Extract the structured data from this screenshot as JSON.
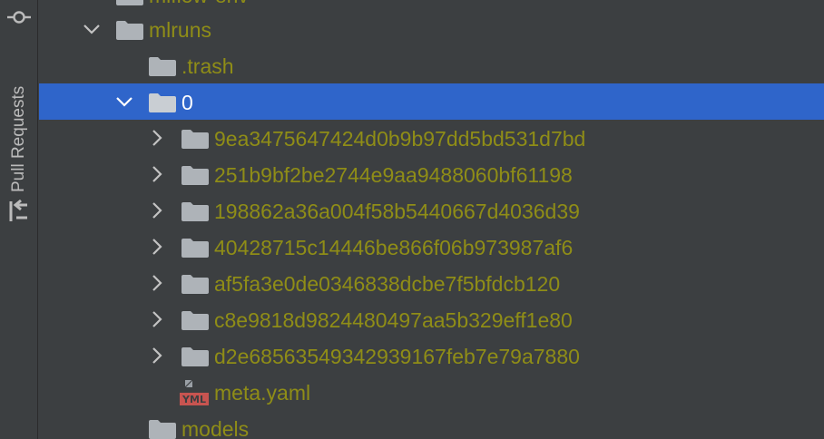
{
  "side_panel": {
    "tab_label": "Pull Requests"
  },
  "tree": {
    "top_clipped_label": "mlflow-env",
    "items": [
      {
        "label": "mlruns"
      },
      {
        "label": ".trash"
      },
      {
        "label": "0"
      },
      {
        "label": "9ea3475647424d0b9b97dd5bd531d7bd"
      },
      {
        "label": "251b9bf2be2744e9aa9488060bf61198"
      },
      {
        "label": "198862a36a004f58b5440667d4036d39"
      },
      {
        "label": "40428715c14446be866f06b973987af6"
      },
      {
        "label": "af5fa3e0de0346838dcbe7f5bfdcb120"
      },
      {
        "label": "c8e9818d9824480497aa5b329eff1e80"
      },
      {
        "label": "d2e68563549342939167feb7e79a7880"
      },
      {
        "label": "meta.yaml",
        "badge": "YML"
      },
      {
        "label": "models"
      }
    ]
  },
  "colors": {
    "background": "#3c3f41",
    "selection": "#2f65ca",
    "tree_text": "#8f8d17",
    "folder_icon": "#aeb3b8",
    "yml_badge": "#c75450"
  }
}
